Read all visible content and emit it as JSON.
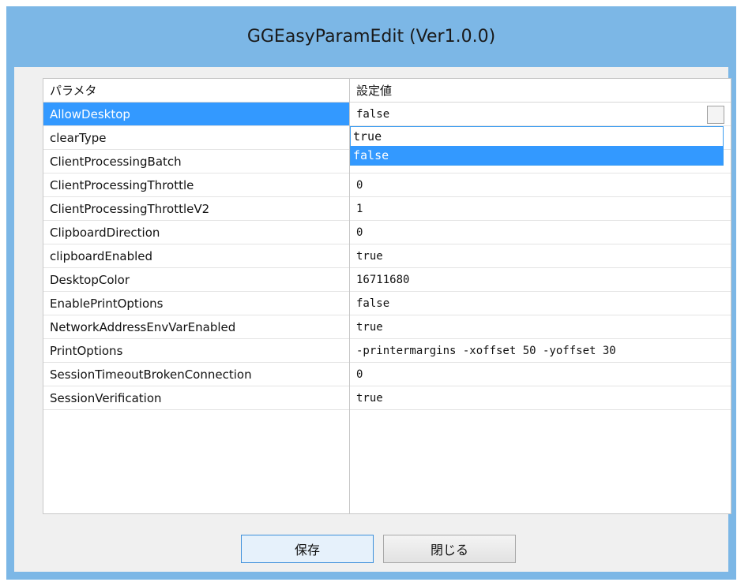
{
  "window": {
    "title": "GGEasyParamEdit (Ver1.0.0)"
  },
  "grid": {
    "headers": {
      "param": "パラメタ",
      "value": "設定値"
    },
    "rows": [
      {
        "name": "AllowDesktop",
        "value": "false"
      },
      {
        "name": "clearType",
        "value": ""
      },
      {
        "name": "ClientProcessingBatch",
        "value": ""
      },
      {
        "name": "ClientProcessingThrottle",
        "value": "0"
      },
      {
        "name": "ClientProcessingThrottleV2",
        "value": "1"
      },
      {
        "name": "ClipboardDirection",
        "value": "0"
      },
      {
        "name": "clipboardEnabled",
        "value": "true"
      },
      {
        "name": "DesktopColor",
        "value": "16711680"
      },
      {
        "name": "EnablePrintOptions",
        "value": "false"
      },
      {
        "name": "NetworkAddressEnvVarEnabled",
        "value": "true"
      },
      {
        "name": "PrintOptions",
        "value": "-printermargins -xoffset 50 -yoffset 30"
      },
      {
        "name": "SessionTimeoutBrokenConnection",
        "value": "0"
      },
      {
        "name": "SessionVerification",
        "value": "true"
      }
    ],
    "selected_row": "AllowDesktop",
    "dropdown": {
      "options": [
        "true",
        "false"
      ],
      "highlighted": "false"
    }
  },
  "buttons": {
    "save_label": "保存",
    "close_label": "閉じる"
  },
  "colors": {
    "title_bar": "#7cb7e6",
    "selection": "#3399ff",
    "client": "#f0f0f0"
  }
}
